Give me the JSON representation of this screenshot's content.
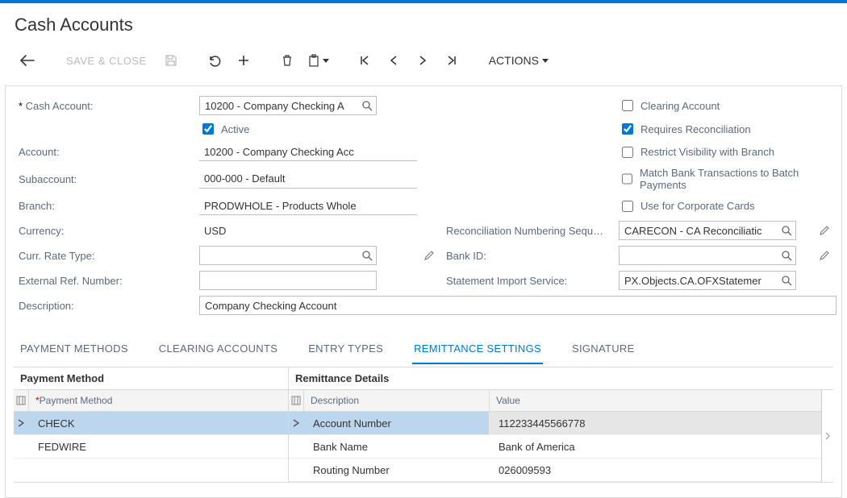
{
  "page_title": "Cash Accounts",
  "toolbar": {
    "save_close": "SAVE & CLOSE",
    "actions": "ACTIONS"
  },
  "form": {
    "cash_account_label": "Cash Account:",
    "cash_account_value": "10200 - Company Checking A",
    "active_label": "Active",
    "active_checked": true,
    "account_label": "Account:",
    "account_value": "10200 - Company Checking Acc",
    "subaccount_label": "Subaccount:",
    "subaccount_value": "000-000 - Default",
    "branch_label": "Branch:",
    "branch_value": "PRODWHOLE - Products Whole",
    "currency_label": "Currency:",
    "currency_value": "USD",
    "curr_rate_type_label": "Curr. Rate Type:",
    "curr_rate_type_value": "",
    "external_ref_label": "External Ref. Number:",
    "external_ref_value": "",
    "description_label": "Description:",
    "description_value": "Company Checking Account",
    "clearing_account_label": "Clearing Account",
    "clearing_account_checked": false,
    "requires_reconciliation_label": "Requires Reconciliation",
    "requires_reconciliation_checked": true,
    "restrict_visibility_label": "Restrict Visibility with Branch",
    "restrict_visibility_checked": false,
    "match_bank_label": "Match Bank Transactions to Batch Payments",
    "match_bank_checked": false,
    "use_corporate_cards_label": "Use for Corporate Cards",
    "use_corporate_cards_checked": false,
    "recon_numbering_label": "Reconciliation Numbering Sequ…",
    "recon_numbering_value": "CARECON - CA Reconciliatic",
    "bank_id_label": "Bank ID:",
    "bank_id_value": "",
    "statement_import_label": "Statement Import Service:",
    "statement_import_value": "PX.Objects.CA.OFXStatemer"
  },
  "tabs": {
    "payment_methods": "PAYMENT METHODS",
    "clearing_accounts": "CLEARING ACCOUNTS",
    "entry_types": "ENTRY TYPES",
    "remittance_settings": "REMITTANCE SETTINGS",
    "signature": "SIGNATURE"
  },
  "payment_method_panel": {
    "title": "Payment Method",
    "header": "Payment Method",
    "rows": [
      "CHECK",
      "FEDWIRE"
    ]
  },
  "remittance_panel": {
    "title": "Remittance Details",
    "header_desc": "Description",
    "header_val": "Value",
    "rows": [
      {
        "desc": "Account Number",
        "val": "112233445566778"
      },
      {
        "desc": "Bank Name",
        "val": "Bank of America"
      },
      {
        "desc": "Routing Number",
        "val": "026009593"
      }
    ]
  }
}
